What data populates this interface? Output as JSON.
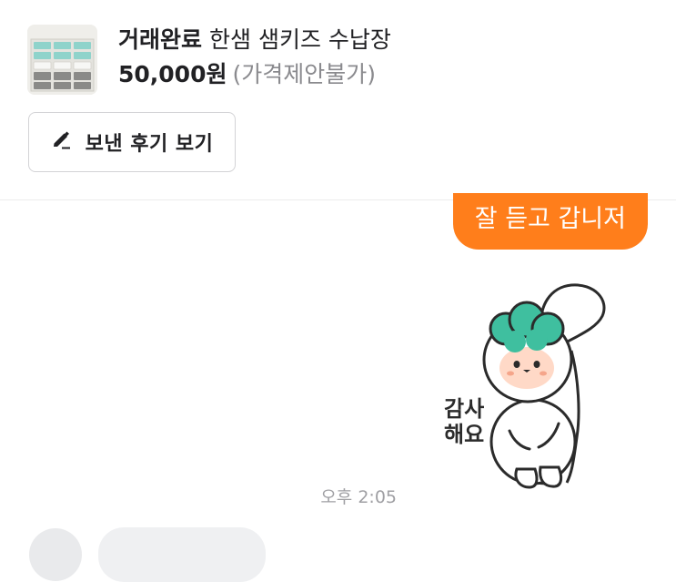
{
  "product": {
    "thumbnail_icon": "storage-cabinet-photo",
    "status": "거래완료",
    "title": "한샘 샘키즈 수납장",
    "price": "50,000원",
    "price_note": "(가격제안불가)"
  },
  "review_button": {
    "icon": "pencil-icon",
    "label": "보낸 후기 보기"
  },
  "messages": {
    "outgoing_text": "잘 듣고 갑니저",
    "sticker_caption": "감사해요",
    "timestamp": "오후 2:05"
  },
  "colors": {
    "accent": "#ff7e1b",
    "sticker_hair": "#3fbf9f",
    "sticker_face": "#ffd9c7"
  }
}
